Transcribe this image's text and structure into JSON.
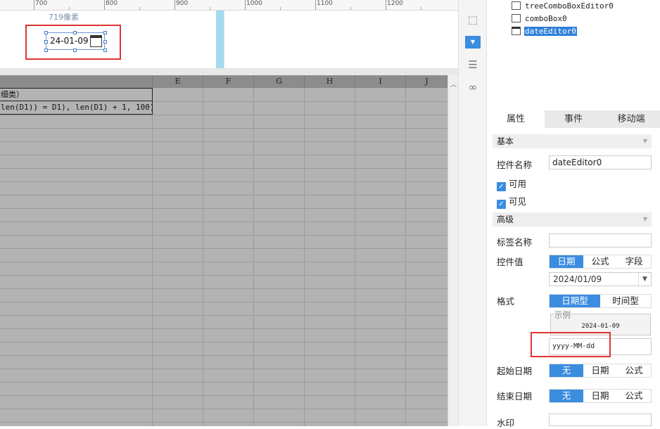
{
  "ruler": {
    "labels": [
      "700",
      "800",
      "900",
      "1000",
      "1100",
      "1200"
    ]
  },
  "design": {
    "pixel_label": "719像素",
    "date_widget_value": "24-01-09"
  },
  "sheet": {
    "columns": [
      "E",
      "F",
      "G",
      "H",
      "I",
      "J"
    ],
    "row1_text": "细类）",
    "row2_text": "len(D1)) = D1), len(D1) + 1, 100)"
  },
  "iconbar": {
    "icons": [
      "crop-icon",
      "combo-dropdown-icon",
      "stack-icon",
      "link-icon"
    ]
  },
  "tree": {
    "items": [
      {
        "label": "treeComboBoxEditor0",
        "icon": "tree-combo-icon"
      },
      {
        "label": "comboBox0",
        "icon": "combo-icon"
      },
      {
        "label": "dateEditor0",
        "icon": "calendar-icon",
        "selected": true
      }
    ]
  },
  "tabs": [
    "属性",
    "事件",
    "移动端"
  ],
  "properties": {
    "basic_section": "基本",
    "control_name_label": "控件名称",
    "control_name_value": "dateEditor0",
    "enabled_label": "可用",
    "visible_label": "可见",
    "advanced_section": "高级",
    "tag_name_label": "标签名称",
    "tag_name_value": "",
    "control_value_label": "控件值",
    "control_value_options": [
      "日期",
      "公式",
      "字段"
    ],
    "control_value_date": "2024/01/09",
    "format_label": "格式",
    "format_options": [
      "日期型",
      "时间型"
    ],
    "example_label": "示例",
    "example_value": "2024-01-09",
    "format_pattern": "yyyy-MM-dd",
    "start_date_label": "起始日期",
    "start_date_options": [
      "无",
      "日期",
      "公式"
    ],
    "end_date_label": "结束日期",
    "end_date_options": [
      "无",
      "日期",
      "公式"
    ],
    "watermark_label": "水印"
  },
  "colors": {
    "accent": "#3b8de0",
    "highlight_box": "#e03333",
    "guide": "#a4dbee",
    "sheet_bg": "#b3b3b3"
  }
}
